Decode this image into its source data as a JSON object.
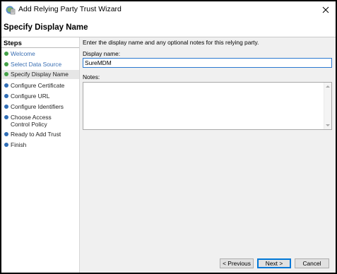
{
  "window": {
    "title": "Add Relying Party Trust Wizard",
    "page_title": "Specify Display Name"
  },
  "steps": {
    "heading": "Steps",
    "items": [
      {
        "label": "Welcome",
        "state": "done"
      },
      {
        "label": "Select Data Source",
        "state": "done"
      },
      {
        "label": "Specify Display Name",
        "state": "current"
      },
      {
        "label": "Configure Certificate",
        "state": "pending"
      },
      {
        "label": "Configure URL",
        "state": "pending"
      },
      {
        "label": "Configure Identifiers",
        "state": "pending"
      },
      {
        "label": "Choose Access Control Policy",
        "state": "pending"
      },
      {
        "label": "Ready to Add Trust",
        "state": "pending"
      },
      {
        "label": "Finish",
        "state": "pending"
      }
    ]
  },
  "form": {
    "instructions": "Enter the display name and any optional notes for this relying party.",
    "display_name_label": "Display name:",
    "display_name_value": "SureMDM",
    "notes_label": "Notes:",
    "notes_value": ""
  },
  "buttons": {
    "previous": "< Previous",
    "next": "Next >",
    "cancel": "Cancel"
  },
  "colors": {
    "dot_done": "#43a047",
    "dot_pending": "#2f6db5",
    "link": "#3a6fb3"
  }
}
